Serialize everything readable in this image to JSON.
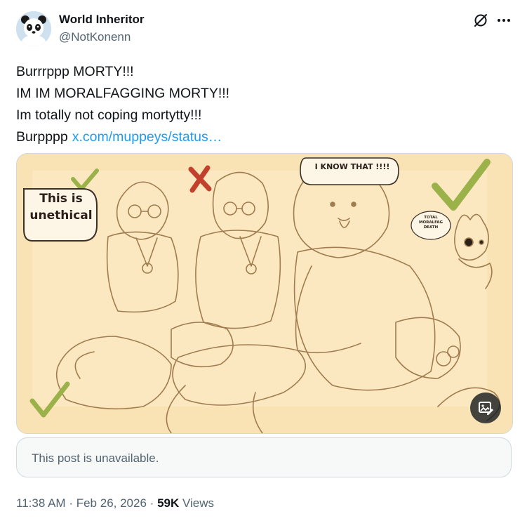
{
  "author": {
    "display_name": "World Inheritor",
    "handle": "@NotKonenn",
    "avatar_icon": "panda-avatar"
  },
  "header_actions": {
    "grok_icon": "grok-icon",
    "more_icon": "more-icon"
  },
  "post": {
    "lines": [
      "Burrrppp MORTY!!!",
      "IM IM MORALFAGGING MORTY!!!",
      "Im totally not coping mortytty!!!",
      "Burpppp"
    ],
    "link_text": "x.com/muppeys/status…"
  },
  "media": {
    "bubble_left": [
      "This is",
      "unethical"
    ],
    "bubble_top": "I KNOW THAT !!!!",
    "bubble_small": [
      "TOTAL",
      "MORALFAG",
      "DEATH"
    ],
    "alt_icon": "image-description-icon"
  },
  "quoted": {
    "unavailable_text": "This post is unavailable."
  },
  "meta": {
    "time": "11:38 AM",
    "separator": "·",
    "date": "Feb 26, 2026",
    "views_count": "59K",
    "views_label": "Views"
  },
  "colors": {
    "text": "#0f1419",
    "secondary": "#536471",
    "link": "#1d9bf0",
    "border": "#cfd9de",
    "art_background": "#f9e2b4",
    "art_line": "#a07c50",
    "check_green": "#9bb24a",
    "x_red": "#c2412c"
  }
}
